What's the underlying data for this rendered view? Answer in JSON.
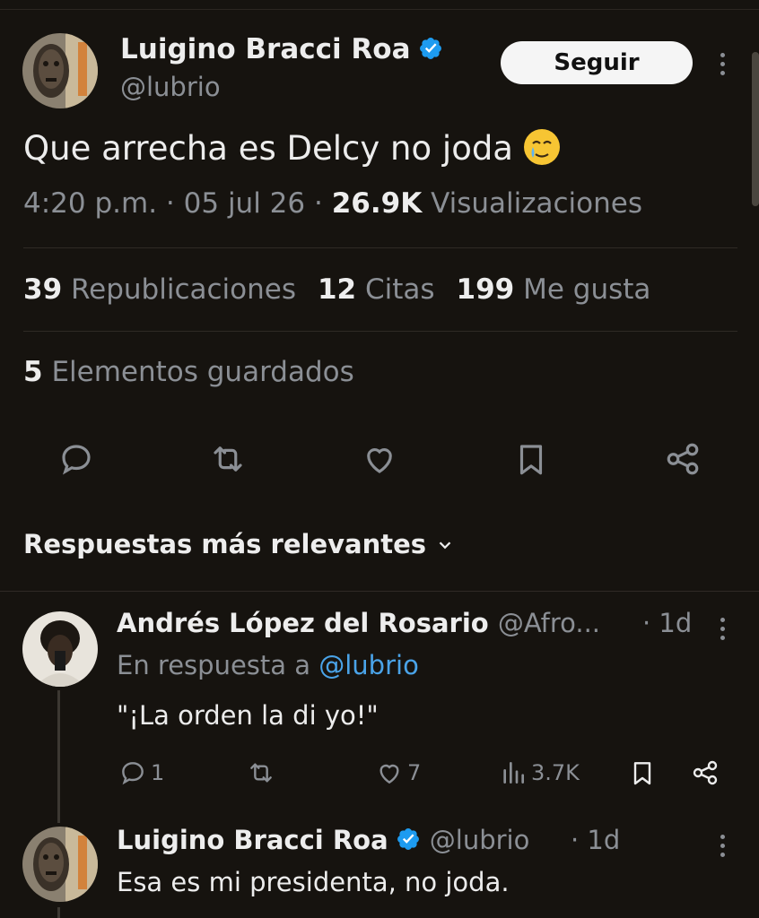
{
  "tweet": {
    "author_name": "Luigino Bracci Roa",
    "author_handle": "@lubrio",
    "follow_label": "Seguir",
    "text": "Que arrecha es Delcy no joda",
    "emoji": "face-holding-back-tears",
    "time": "4:20 p.m.",
    "date": "05 jul 26",
    "separator": "·",
    "views_count": "26.9K",
    "views_label": "Visualizaciones",
    "reposts_count": "39",
    "reposts_label": "Republicaciones",
    "quotes_count": "12",
    "quotes_label": "Citas",
    "likes_count": "199",
    "likes_label": "Me gusta",
    "bookmarks_count": "5",
    "bookmarks_label": "Elementos guardados"
  },
  "actions": [
    "reply-icon",
    "retweet-icon",
    "like-icon",
    "bookmark-icon",
    "share-icon"
  ],
  "replies_header": "Respuestas más relevantes",
  "replies": [
    {
      "name": "Andrés López del Rosario",
      "handle": "@Afro...",
      "time": "· 1d",
      "reply_prefix": "En respuesta a",
      "reply_to": "@lubrio",
      "text": "\"¡La orden la di yo!\"",
      "reply_count": "1",
      "like_count": "7",
      "views": "3.7K"
    },
    {
      "name": "Luigino Bracci Roa",
      "handle": "@lubrio",
      "time": "· 1d",
      "text": "Esa es mi presidenta, no joda."
    }
  ],
  "colors": {
    "background": "#16130f",
    "text": "#ededed",
    "muted": "#8b8f95",
    "link": "#4aa3e8",
    "verified": "#1d9bf0"
  }
}
